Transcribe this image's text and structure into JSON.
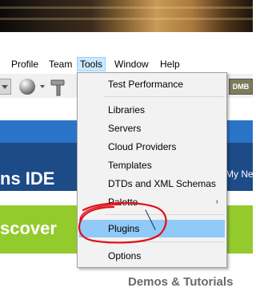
{
  "menubar": {
    "items": [
      {
        "label": "Profile"
      },
      {
        "label": "Team"
      },
      {
        "label": "Tools",
        "active": true
      },
      {
        "label": "Window"
      },
      {
        "label": "Help"
      }
    ]
  },
  "toolbar": {
    "right_icon_text": "DMB"
  },
  "background_page": {
    "ide_text": "ns IDE",
    "my_text": "My Ne",
    "discover_text": "scover",
    "demos_text": "Demos & Tutorials"
  },
  "tools_menu": {
    "items": [
      {
        "label": "Test Performance"
      },
      {
        "label": "Libraries"
      },
      {
        "label": "Servers"
      },
      {
        "label": "Cloud Providers"
      },
      {
        "label": "Templates"
      },
      {
        "label": "DTDs and XML Schemas"
      },
      {
        "label": "Palette",
        "submenu": "›"
      },
      {
        "label": "Plugins",
        "highlighted": true
      },
      {
        "label": "Options"
      }
    ]
  },
  "colors": {
    "menu_active_bg": "#cce8ff",
    "menu_hover_bg": "#91c9f7",
    "annotation_red": "#e0101a",
    "banner_blue": "#1c4b87",
    "banner_green": "#93cb2d"
  }
}
